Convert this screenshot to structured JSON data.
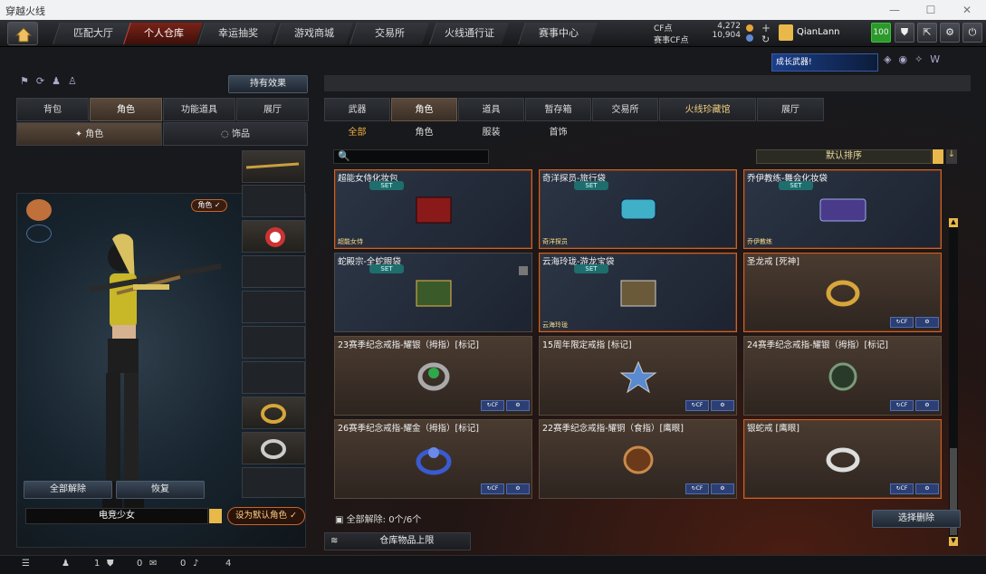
{
  "window": {
    "title": "穿越火线",
    "min": "—",
    "max": "☐",
    "close": "✕"
  },
  "nav": {
    "tabs": [
      "匹配大厅",
      "个人仓库",
      "幸运抽奖",
      "游戏商城",
      "交易所",
      "火线通行证",
      "赛事中心"
    ],
    "active": 1
  },
  "currency": {
    "cf_label": "CF点",
    "cf_value": "4,272",
    "match_label": "赛事CF点",
    "match_value": "10,904"
  },
  "user": {
    "name": "QianLann",
    "level": "100"
  },
  "left": {
    "effect_button": "持有效果",
    "tabs": [
      "背包",
      "角色",
      "功能道具",
      "展厅"
    ],
    "subtabs": [
      "角色",
      "饰品"
    ],
    "role_badge": "角色 ✓",
    "unequip_all": "全部解除",
    "restore": "恢复",
    "char_name": "电竞少女",
    "set_default": "设为默认角色 ✓"
  },
  "right": {
    "tabs": [
      "武器",
      "角色",
      "道具",
      "暂存箱",
      "交易所",
      "火线珍藏馆",
      "展厅"
    ],
    "active_tab": 1,
    "subtabs": [
      "全部",
      "角色",
      "服装",
      "首饰"
    ],
    "sort_label": "默认排序",
    "search": {
      "placeholder": ""
    },
    "items": [
      {
        "name": "超能女侍化妆包",
        "set": "SET",
        "owner": "超能女侍",
        "style": "blue",
        "sel": true,
        "art": "red-box"
      },
      {
        "name": "奇洋探员-旅行袋",
        "set": "SET",
        "owner": "奇洋探员",
        "style": "blue",
        "sel": true,
        "art": "cyan-can"
      },
      {
        "name": "乔伊教练-舞会化妆袋",
        "set": "SET",
        "owner": "乔伊教练",
        "style": "blue",
        "sel": true,
        "art": "hex-bag"
      },
      {
        "name": "蛇殿宗-全蛇眼袋",
        "set": "SET",
        "owner": "",
        "style": "blue",
        "sel": false,
        "art": "green-box"
      },
      {
        "name": "云海玲珑-游龙宝袋",
        "set": "SET",
        "owner": "云海玲珑",
        "style": "blue",
        "sel": true,
        "art": "gold-box"
      },
      {
        "name": "圣龙戒 [死神]",
        "set": "",
        "owner": "",
        "style": "brown",
        "sel": true,
        "art": "ring-gold"
      },
      {
        "name": "23赛季纪念戒指-耀银（拇指）[标记]",
        "set": "",
        "owner": "",
        "style": "brown",
        "sel": false,
        "art": "ring-green"
      },
      {
        "name": "15周年限定戒指 [标记]",
        "set": "",
        "owner": "",
        "style": "brown",
        "sel": false,
        "art": "ring-star"
      },
      {
        "name": "24赛季纪念戒指-耀银（拇指）[标记]",
        "set": "",
        "owner": "",
        "style": "brown",
        "sel": false,
        "art": "ring-dark"
      },
      {
        "name": "26赛季纪念戒指-耀金（拇指）[标记]",
        "set": "",
        "owner": "",
        "style": "brown",
        "sel": false,
        "art": "ring-blue"
      },
      {
        "name": "22赛季纪念戒指-耀铜（食指）[鹰眼]",
        "set": "",
        "owner": "",
        "style": "brown",
        "sel": false,
        "art": "ring-bronze"
      },
      {
        "name": "银蛇戒 [鹰眼]",
        "set": "",
        "owner": "",
        "style": "brown",
        "sel": true,
        "art": "ring-silver"
      }
    ],
    "unequip_status": "全部解除: 0个/6个",
    "select_delete": "选择删除",
    "storage_limit": "仓库物品上限"
  },
  "bottom": {
    "count1": "1",
    "count2": "0",
    "count3": "0",
    "count4": "4"
  },
  "colors": {
    "accent_orange": "#c5652c",
    "active_red": "#7a2318",
    "gold": "#e8b84a"
  }
}
